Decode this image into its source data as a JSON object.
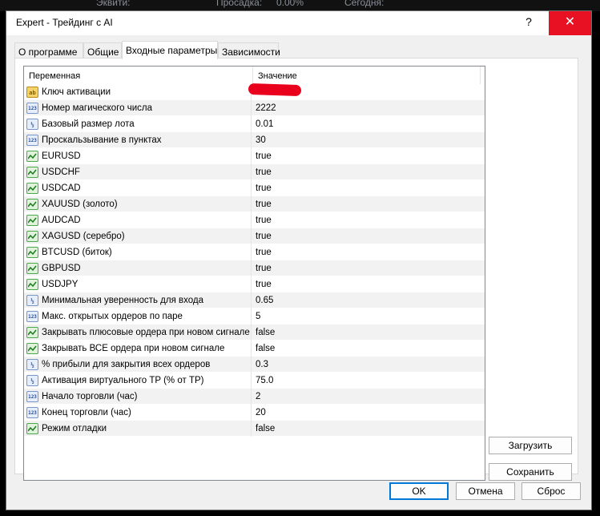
{
  "background_strip": {
    "texts": [
      "Эквити:",
      "Просадка:",
      "0.00%",
      "Сегодня:"
    ]
  },
  "window": {
    "title": "Expert - Трейдинг с AI",
    "help_label": "?",
    "close_label": "✕"
  },
  "tabs": [
    {
      "label": "О программе",
      "active": false
    },
    {
      "label": "Общие",
      "active": false
    },
    {
      "label": "Входные параметры",
      "active": true
    },
    {
      "label": "Зависимости",
      "active": false
    }
  ],
  "grid": {
    "col_variable": "Переменная",
    "col_value": "Значение",
    "rows": [
      {
        "type": "ab",
        "name": "Ключ активации",
        "value": ""
      },
      {
        "type": "num",
        "name": "Номер магического числа",
        "value": "2222"
      },
      {
        "type": "dbl",
        "name": "Базовый размер лота",
        "value": "0.01"
      },
      {
        "type": "num",
        "name": "Проскальзывание в пунктах",
        "value": "30"
      },
      {
        "type": "bool",
        "name": "EURUSD",
        "value": "true"
      },
      {
        "type": "bool",
        "name": "USDCHF",
        "value": "true"
      },
      {
        "type": "bool",
        "name": "USDCAD",
        "value": "true"
      },
      {
        "type": "bool",
        "name": "XAUUSD (золото)",
        "value": "true"
      },
      {
        "type": "bool",
        "name": "AUDCAD",
        "value": "true"
      },
      {
        "type": "bool",
        "name": "XAGUSD (серебро)",
        "value": "true"
      },
      {
        "type": "bool",
        "name": "BTCUSD (биток)",
        "value": "true"
      },
      {
        "type": "bool",
        "name": "GBPUSD",
        "value": "true"
      },
      {
        "type": "bool",
        "name": "USDJPY",
        "value": "true"
      },
      {
        "type": "dbl",
        "name": "Минимальная уверенность для входа",
        "value": "0.65"
      },
      {
        "type": "num",
        "name": "Макс. открытых ордеров по паре",
        "value": "5"
      },
      {
        "type": "bool",
        "name": "Закрывать плюсовые ордера при новом сигнале",
        "value": "false"
      },
      {
        "type": "bool",
        "name": "Закрывать ВСЕ ордера при новом сигнале",
        "value": "false"
      },
      {
        "type": "dbl",
        "name": "% прибыли для закрытия всех ордеров",
        "value": "0.3"
      },
      {
        "type": "dbl",
        "name": "Активация виртуального TP (% от TP)",
        "value": "75.0"
      },
      {
        "type": "num",
        "name": "Начало торговли (час)",
        "value": "2"
      },
      {
        "type": "num",
        "name": "Конец торговли (час)",
        "value": "20"
      },
      {
        "type": "bool",
        "name": "Режим отладки",
        "value": "false"
      }
    ]
  },
  "side_buttons": {
    "load": "Загрузить",
    "save": "Сохранить"
  },
  "footer_buttons": {
    "ok": "OK",
    "cancel": "Отмена",
    "reset": "Сброс"
  },
  "icons": {
    "ab": "string-type-icon",
    "num": "integer-type-icon",
    "dbl": "double-type-icon",
    "bool": "boolean-type-icon"
  },
  "colors": {
    "close_button": "#e81123",
    "primary_border": "#0078d7",
    "redaction": "#e8001c"
  }
}
